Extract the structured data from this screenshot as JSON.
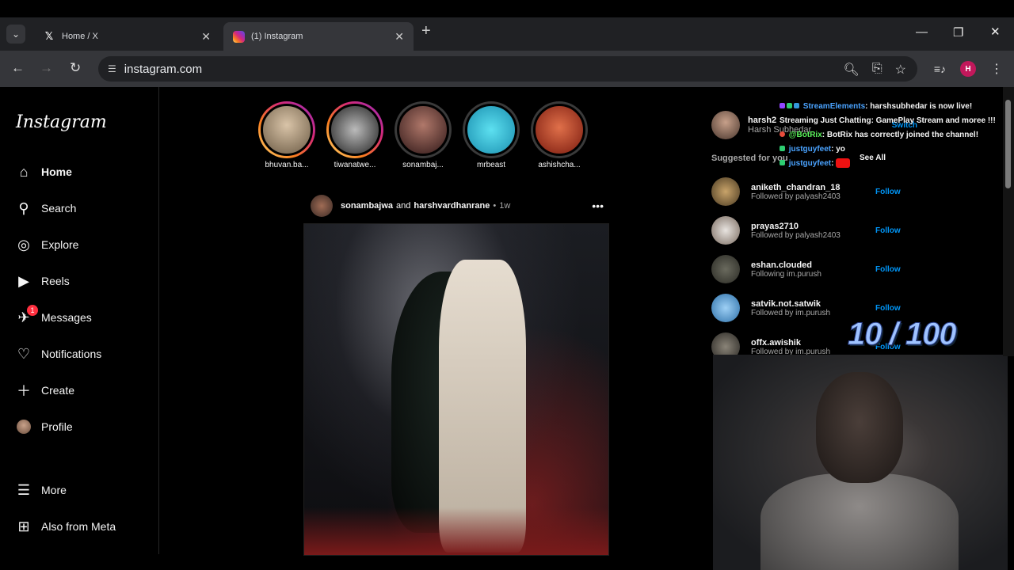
{
  "browser": {
    "tabs": [
      {
        "title": "Home / X",
        "icon": "x-logo-icon",
        "active": false
      },
      {
        "title": "(1) Instagram",
        "icon": "instagram-icon",
        "active": true
      }
    ],
    "url": "instagram.com",
    "profile_initial": "H"
  },
  "instagram": {
    "logo": "Instagram",
    "nav": [
      {
        "label": "Home",
        "icon": "home-icon",
        "active": true
      },
      {
        "label": "Search",
        "icon": "search-icon"
      },
      {
        "label": "Explore",
        "icon": "compass-icon"
      },
      {
        "label": "Reels",
        "icon": "reels-icon"
      },
      {
        "label": "Messages",
        "icon": "messenger-icon",
        "badge": "1"
      },
      {
        "label": "Notifications",
        "icon": "heart-icon"
      },
      {
        "label": "Create",
        "icon": "plus-icon"
      },
      {
        "label": "Profile",
        "icon": "avatar"
      },
      {
        "label": "More",
        "icon": "hamburger-icon"
      },
      {
        "label": "Also from Meta",
        "icon": "meta-apps-icon"
      }
    ],
    "stories": [
      {
        "name": "bhuvan.ba...",
        "seen": false
      },
      {
        "name": "tiwanatwe...",
        "seen": false
      },
      {
        "name": "sonambaj...",
        "seen": true
      },
      {
        "name": "mrbeast",
        "seen": true
      },
      {
        "name": "ashishcha...",
        "seen": true
      }
    ],
    "post": {
      "user1": "sonambajwa",
      "conj": "and",
      "user2": "harshvardhanrane",
      "dot": "•",
      "time": "1w"
    },
    "account": {
      "username": "harsh2",
      "name": "Harsh Subhedar",
      "switch": "Switch"
    },
    "suggested_title": "Suggested for you",
    "see_all": "See All",
    "suggestions": [
      {
        "user": "aniketh_chandran_18",
        "sub": "Followed by palyash2403",
        "action": "Follow"
      },
      {
        "user": "prayas2710",
        "sub": "Followed by palyash2403",
        "action": "Follow"
      },
      {
        "user": "eshan.clouded",
        "sub": "Following im.purush",
        "action": "Follow"
      },
      {
        "user": "satvik.not.satwik",
        "sub": "Followed by im.purush",
        "action": "Follow"
      },
      {
        "user": "offx.awishik",
        "sub": "Followed by im.purush",
        "action": "Follow"
      }
    ]
  },
  "stream_overlay": {
    "chat": [
      {
        "user": "StreamElements",
        "text": ": harshsubhedar is now live! Streaming Just Chatting: GamePlay Stream and moree !!!"
      },
      {
        "user": "@BotRix",
        "text": ": BotRix has correctly joined the channel!"
      },
      {
        "user": "justguyfeet",
        "text": ": yo"
      },
      {
        "user": "justguyfeet",
        "text": ":"
      }
    ],
    "counter": "10 / 100"
  }
}
